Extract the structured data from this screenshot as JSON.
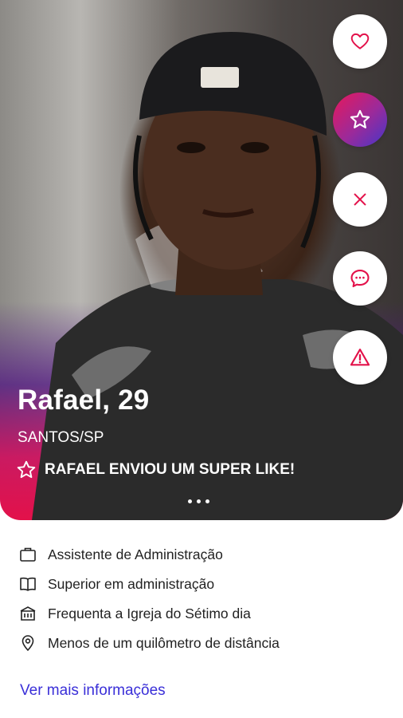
{
  "profile": {
    "name_age": "Rafael, 29",
    "location": "SANTOS/SP",
    "super_like_text": "RAFAEL ENVIOU UM SUPER LIKE!"
  },
  "actions": [
    {
      "icon": "heart-icon"
    },
    {
      "icon": "star-icon"
    },
    {
      "icon": "close-icon"
    },
    {
      "icon": "chat-icon"
    },
    {
      "icon": "warning-icon"
    }
  ],
  "details": [
    {
      "icon": "briefcase-icon",
      "text": "Assistente de Administração"
    },
    {
      "icon": "book-icon",
      "text": "Superior em administração"
    },
    {
      "icon": "church-icon",
      "text": "Frequenta a Igreja do Sétimo dia"
    },
    {
      "icon": "location-pin-icon",
      "text": "Menos de um quilômetro de distância"
    }
  ],
  "more_link": "Ver mais informações",
  "colors": {
    "accent": "#e3114a",
    "link": "#3a2fd8",
    "purple": "#5a20a0"
  }
}
